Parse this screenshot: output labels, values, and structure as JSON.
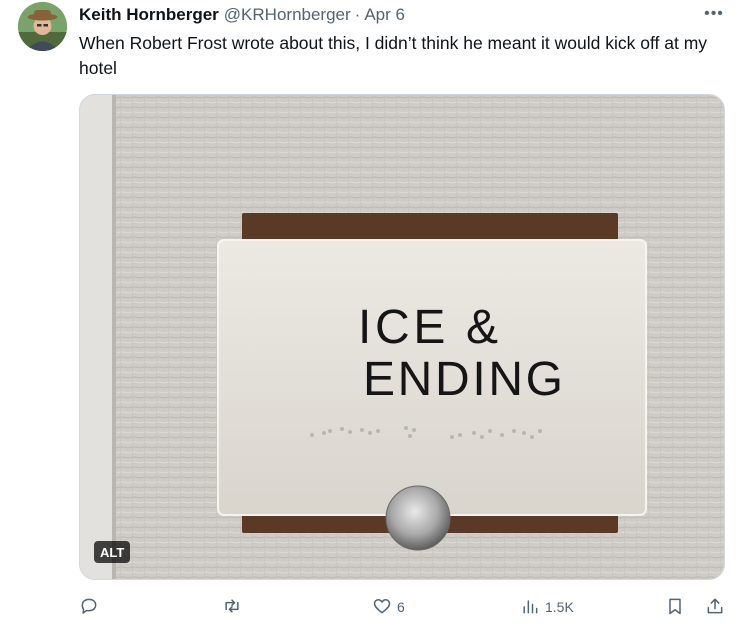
{
  "tweet": {
    "author_name": "Keith Hornberger",
    "handle": "@KRHornberger",
    "separator": "·",
    "date": "Apr 6",
    "more_label": "•••",
    "text": "When Robert Frost wrote about this, I didn’t think he meant it would kick off at my hotel"
  },
  "media": {
    "sign_line1": "ICE &",
    "sign_line2": "ENDING",
    "alt_badge": "ALT"
  },
  "actions": {
    "reply_count": "",
    "retweet_count": "",
    "like_count": "6",
    "views_count": "1.5K"
  },
  "icons": {
    "reply": "reply-icon",
    "retweet": "retweet-icon",
    "like": "heart-icon",
    "views": "views-chart-icon",
    "bookmark": "bookmark-icon",
    "share": "share-icon"
  }
}
